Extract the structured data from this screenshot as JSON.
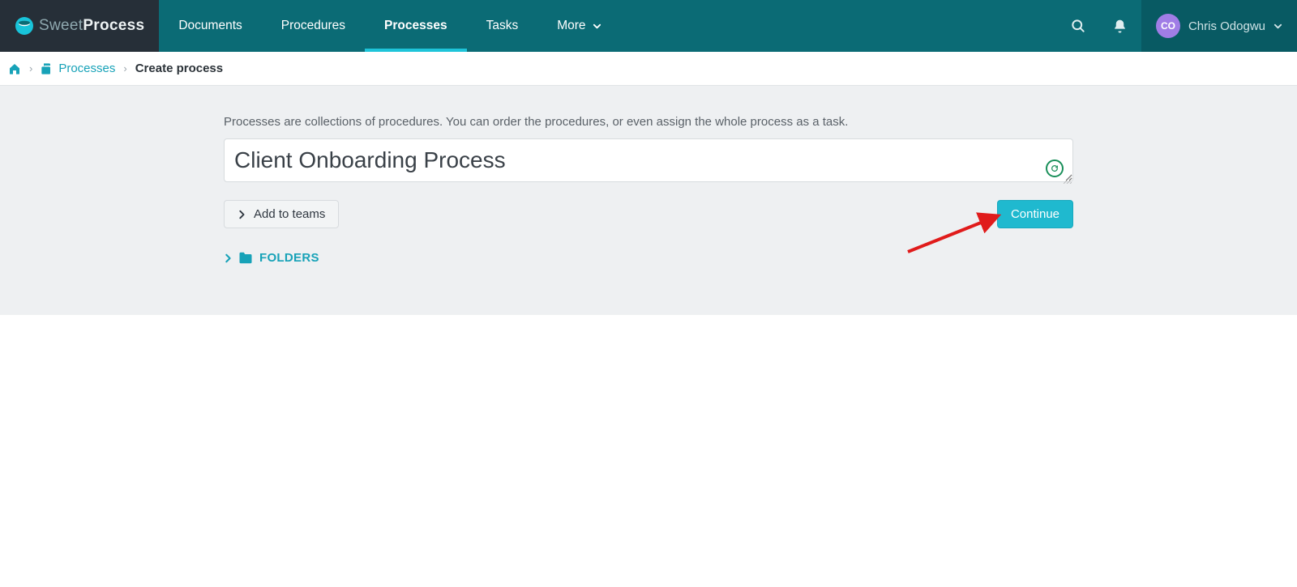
{
  "brand": {
    "sweet": "Sweet",
    "process": "Process"
  },
  "nav": {
    "documents": "Documents",
    "procedures": "Procedures",
    "processes": "Processes",
    "tasks": "Tasks",
    "more": "More"
  },
  "user": {
    "initials": "CO",
    "name": "Chris Odogwu"
  },
  "breadcrumb": {
    "processes": "Processes",
    "current": "Create process"
  },
  "main": {
    "helper": "Processes are collections of procedures. You can order the procedures, or even assign the whole process as a task.",
    "title_value": "Client Onboarding Process",
    "add_to_teams": "Add to teams",
    "continue": "Continue",
    "folders": "FOLDERS"
  }
}
